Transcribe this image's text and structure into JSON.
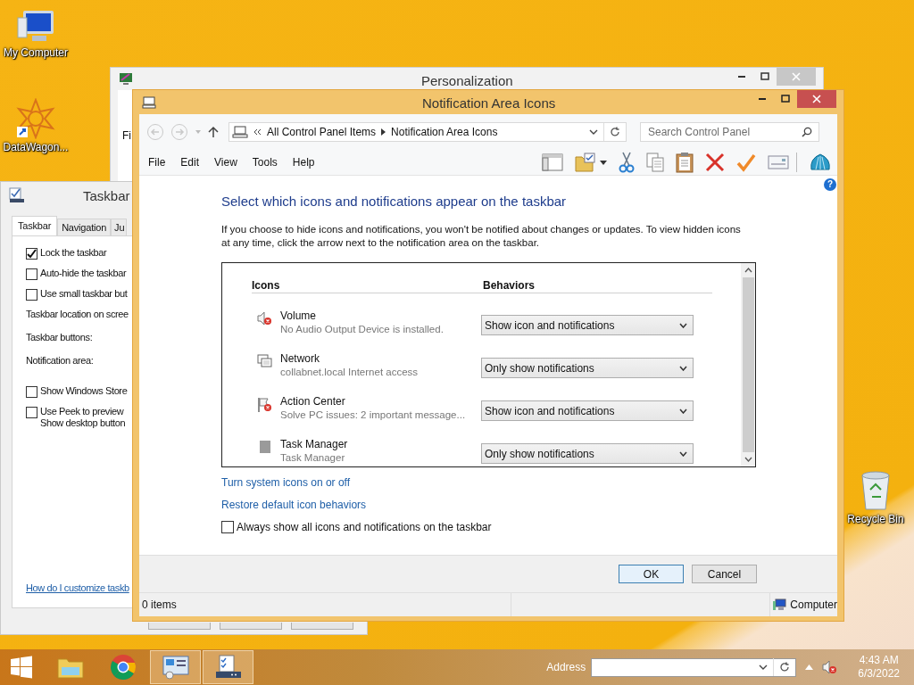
{
  "desktop_icons": [
    {
      "kind": "computer",
      "label": "My Computer"
    },
    {
      "kind": "app-shortcut",
      "label": "DataWagon..."
    },
    {
      "kind": "recycle-bin",
      "label": "Recycle Bin"
    }
  ],
  "personalization": {
    "title": "Personalization",
    "menu_fragment": "Fi"
  },
  "taskbar_properties": {
    "title": "Taskbar",
    "tabs": [
      {
        "label": "Taskbar",
        "selected": true
      },
      {
        "label": "Navigation",
        "selected": false
      },
      {
        "label": "Ju",
        "selected": false
      }
    ],
    "options": [
      {
        "kind": "checkbox",
        "lines": [
          "Lock the taskbar"
        ],
        "checked": true
      },
      {
        "kind": "checkbox",
        "lines": [
          "Auto-hide the taskbar"
        ],
        "checked": false
      },
      {
        "kind": "checkbox",
        "lines": [
          "Use small taskbar but"
        ],
        "checked": false
      },
      {
        "kind": "label",
        "lines": [
          "Taskbar location on scree"
        ]
      },
      {
        "kind": "label",
        "lines": [
          "Taskbar buttons:"
        ]
      },
      {
        "kind": "label",
        "lines": [
          "Notification area:"
        ]
      },
      {
        "kind": "checkbox",
        "lines": [
          "Show Windows Store"
        ],
        "checked": false
      },
      {
        "kind": "checkbox",
        "lines": [
          "Use Peek to preview",
          "Show desktop button"
        ],
        "checked": false
      }
    ],
    "help_link": "How do I customize taskb"
  },
  "window": {
    "title": "Notification Area Icons",
    "breadcrumb": [
      "All Control Panel Items",
      "Notification Area Icons"
    ],
    "search_placeholder": "Search Control Panel",
    "menu": [
      "File",
      "Edit",
      "View",
      "Tools",
      "Help"
    ],
    "heading": "Select which icons and notifications appear on the taskbar",
    "description": "If you choose to hide icons and notifications, you won't be notified about changes or updates. To view hidden icons at any time, click the arrow next to the notification area on the taskbar.",
    "columns": [
      "Icons",
      "Behaviors"
    ],
    "help_glyph": "?",
    "items": [
      {
        "kind": "volume",
        "name": "Volume",
        "detail": "No Audio Output Device is installed.",
        "behavior": "Show icon and notifications"
      },
      {
        "kind": "network",
        "name": "Network",
        "detail": "collabnet.local Internet access",
        "behavior": "Only show notifications"
      },
      {
        "kind": "action-center",
        "name": "Action Center",
        "detail": "Solve PC issues: 2 important message...",
        "behavior": "Show icon and notifications"
      },
      {
        "kind": "generic",
        "name": "Task Manager",
        "detail": "Task Manager",
        "behavior": "Only show notifications"
      }
    ],
    "links": [
      "Turn system icons on or off",
      "Restore default icon behaviors"
    ],
    "always_show": {
      "label": "Always show all icons and notifications on the taskbar",
      "checked": false
    },
    "buttons": [
      {
        "label": "OK",
        "default": true
      },
      {
        "label": "Cancel",
        "default": false
      }
    ],
    "status_bar": {
      "count": "0 items",
      "location": "Computer"
    }
  },
  "taskbar": {
    "apps": [
      {
        "kind": "explorer",
        "active": false
      },
      {
        "kind": "chrome",
        "active": false
      },
      {
        "kind": "control-panel",
        "active": true
      },
      {
        "kind": "taskbar-settings",
        "active": true
      }
    ],
    "address_label": "Address",
    "time": "4:43 AM",
    "date": "6/3/2022"
  }
}
